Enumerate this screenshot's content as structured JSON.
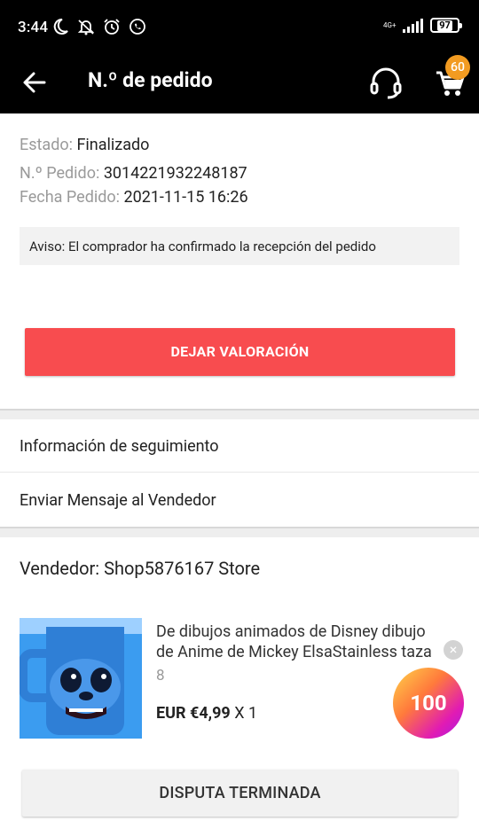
{
  "status_bar": {
    "time": "3:44",
    "network": "4G+",
    "battery": "97"
  },
  "app_bar": {
    "title": "N.º de pedido",
    "cart_count": "60"
  },
  "order": {
    "status_label": "Estado:",
    "status_value": "Finalizado",
    "number_label": "N.º Pedido:",
    "number_value": "3014221932248187",
    "date_label": "Fecha Pedido:",
    "date_value": "2021-11-15 16:26",
    "notice": "Aviso: El comprador ha confirmado la recepción del pedido",
    "review_button": "DEJAR VALORACIÓN"
  },
  "links": {
    "tracking": "Información de seguimiento",
    "message_seller": "Enviar Mensaje al Vendedor"
  },
  "seller": {
    "label": "Vendedor: Shop5876167 Store"
  },
  "product": {
    "title_line1": "De dibujos animados de Disney dibujo",
    "title_line2": "de Anime de Mickey ElsaStainless taza",
    "variant": "8",
    "price": "EUR €4,99",
    "quantity": "X 1"
  },
  "floating_coin": {
    "value": "100"
  },
  "dispute_button": "DISPUTA TERMINADA",
  "colors": {
    "primary_red": "#f84c4f",
    "badge_orange": "#f29b21"
  }
}
